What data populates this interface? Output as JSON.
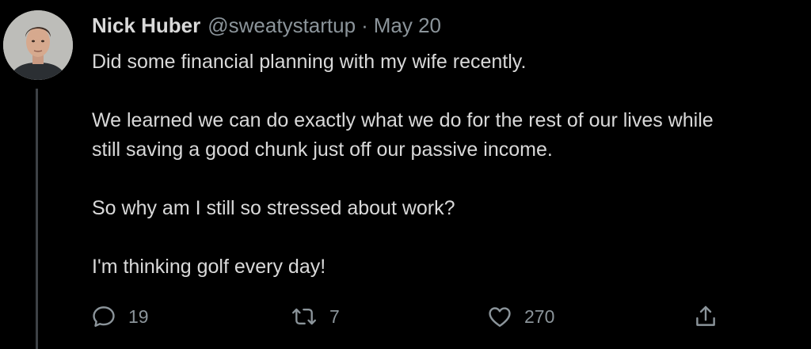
{
  "tweet": {
    "author": {
      "display_name": "Nick Huber",
      "handle": "@sweatystartup",
      "avatar_icon": "profile-photo"
    },
    "separator": "·",
    "date": "May 20",
    "paragraphs": [
      "Did some financial planning with my wife recently.",
      "We learned we can do exactly what we do for the rest of our lives while",
      "So why am I still so stressed about work?",
      "I'm thinking golf every day!"
    ],
    "paragraph_2_line_2": "still saving a good chunk just off our passive income.",
    "actions": {
      "reply": {
        "icon": "reply-icon",
        "count": "19"
      },
      "retweet": {
        "icon": "retweet-icon",
        "count": "7"
      },
      "like": {
        "icon": "heart-icon",
        "count": "270"
      },
      "share": {
        "icon": "share-icon"
      }
    }
  },
  "colors": {
    "background": "#000000",
    "primary_text": "#d9d9d9",
    "secondary_text": "#8b949a",
    "thread_line": "#3d4146"
  }
}
